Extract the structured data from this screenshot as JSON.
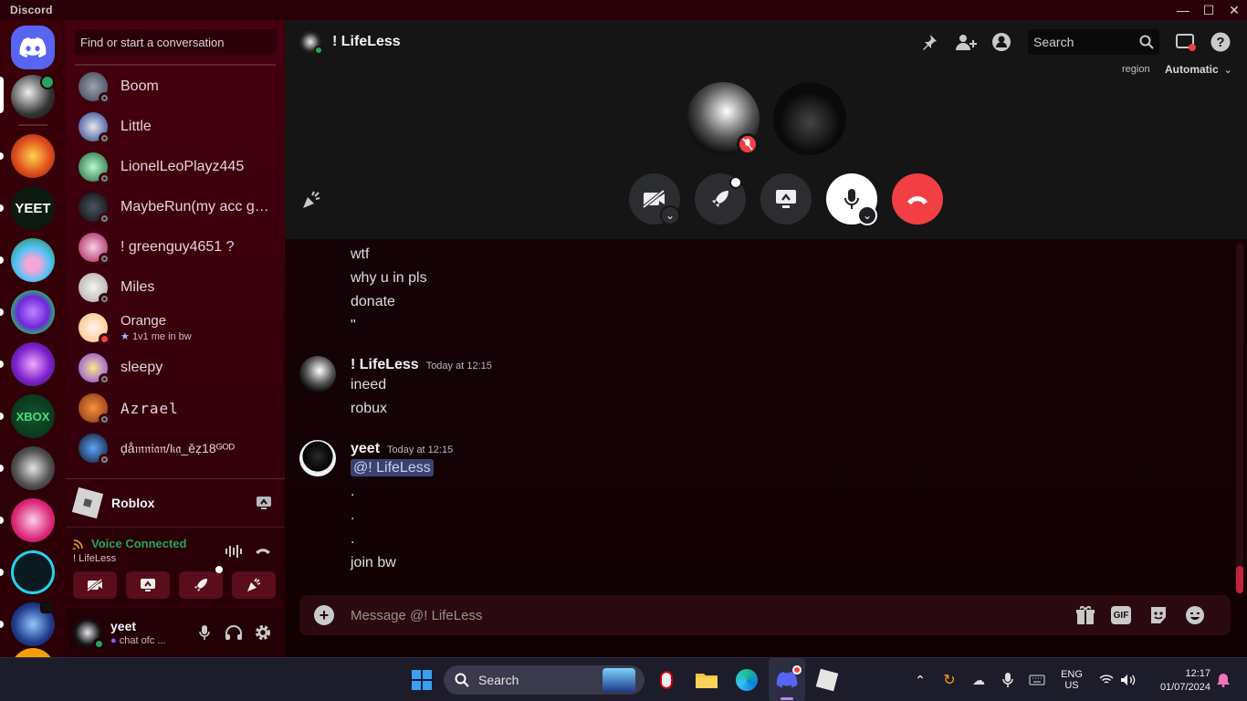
{
  "window": {
    "title": "Discord"
  },
  "dm_sidebar": {
    "search_placeholder": "Find or start a conversation",
    "items": [
      {
        "name": "Boom",
        "status": "offline"
      },
      {
        "name": "Little",
        "status": "offline"
      },
      {
        "name": "LionelLeoPlayz445",
        "status": "offline"
      },
      {
        "name": "MaybeRun(my acc got...",
        "status": "offline"
      },
      {
        "name": "! greenguy4651 ?",
        "status": "offline"
      },
      {
        "name": "Miles",
        "status": "offline"
      },
      {
        "name": "Orange",
        "status": "dnd",
        "custom_status": "1v1 me in bw"
      },
      {
        "name": "sleepy",
        "status": "offline"
      },
      {
        "name": "Azrael",
        "status": "offline"
      },
      {
        "name": "ḑå𝔪𝔫𝔦𝔞𝔫/𝔨𝔞_ěẓ18ᴳᴼᴰ",
        "status": "offline"
      }
    ],
    "activity": {
      "game": "Roblox"
    },
    "voice": {
      "status": "Voice Connected",
      "channel": "! LifeLess"
    },
    "user": {
      "name": "yeet",
      "status_text": "chat ofc ..."
    }
  },
  "chat": {
    "recipient": "! LifeLess",
    "search_placeholder": "Search",
    "region_label": "region",
    "region_value": "Automatic",
    "messages": [
      {
        "type": "continued",
        "text": "wtf"
      },
      {
        "type": "continued",
        "text": "why u in pls"
      },
      {
        "type": "continued",
        "text": "donate"
      },
      {
        "type": "continued",
        "text": "\""
      },
      {
        "type": "header",
        "author": "! LifeLess",
        "timestamp": "Today at 12:15",
        "lines": [
          "ineed",
          "robux"
        ]
      },
      {
        "type": "header",
        "author": "yeet",
        "timestamp": "Today at 12:15",
        "mention": "@! LifeLess",
        "lines": [
          ".",
          ".",
          ".",
          "join bw"
        ]
      }
    ],
    "composer_placeholder": "Message @! LifeLess",
    "composer_gif": "GIF"
  },
  "taskbar": {
    "search_label": "Search",
    "lang_top": "ENG",
    "lang_bottom": "US",
    "time": "12:17",
    "date": "01/07/2024"
  },
  "colors": {
    "accent": "#5865f2",
    "danger": "#f23f43",
    "online": "#23a55a",
    "voice": "#23a55a"
  }
}
